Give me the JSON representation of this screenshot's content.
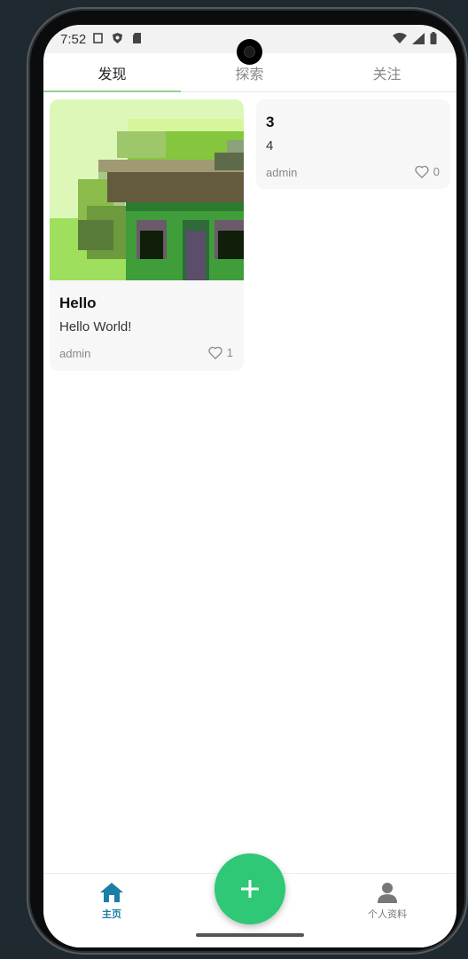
{
  "status_bar": {
    "time": "7:52"
  },
  "tabs": [
    {
      "label": "发现",
      "active": true
    },
    {
      "label": "探索",
      "active": false
    },
    {
      "label": "关注",
      "active": false
    }
  ],
  "posts": [
    {
      "title": "Hello",
      "body": "Hello World!",
      "author": "admin",
      "likes": "1",
      "has_image": true
    },
    {
      "title": "3",
      "body": "4",
      "author": "admin",
      "likes": "0",
      "has_image": false
    }
  ],
  "bottom_nav": {
    "home_label": "主页",
    "profile_label": "个人资料",
    "fab_icon": "plus-icon"
  },
  "colors": {
    "accent": "#1b7ea8",
    "fab": "#2ec876",
    "tab_indicator": "#8fd48f"
  }
}
